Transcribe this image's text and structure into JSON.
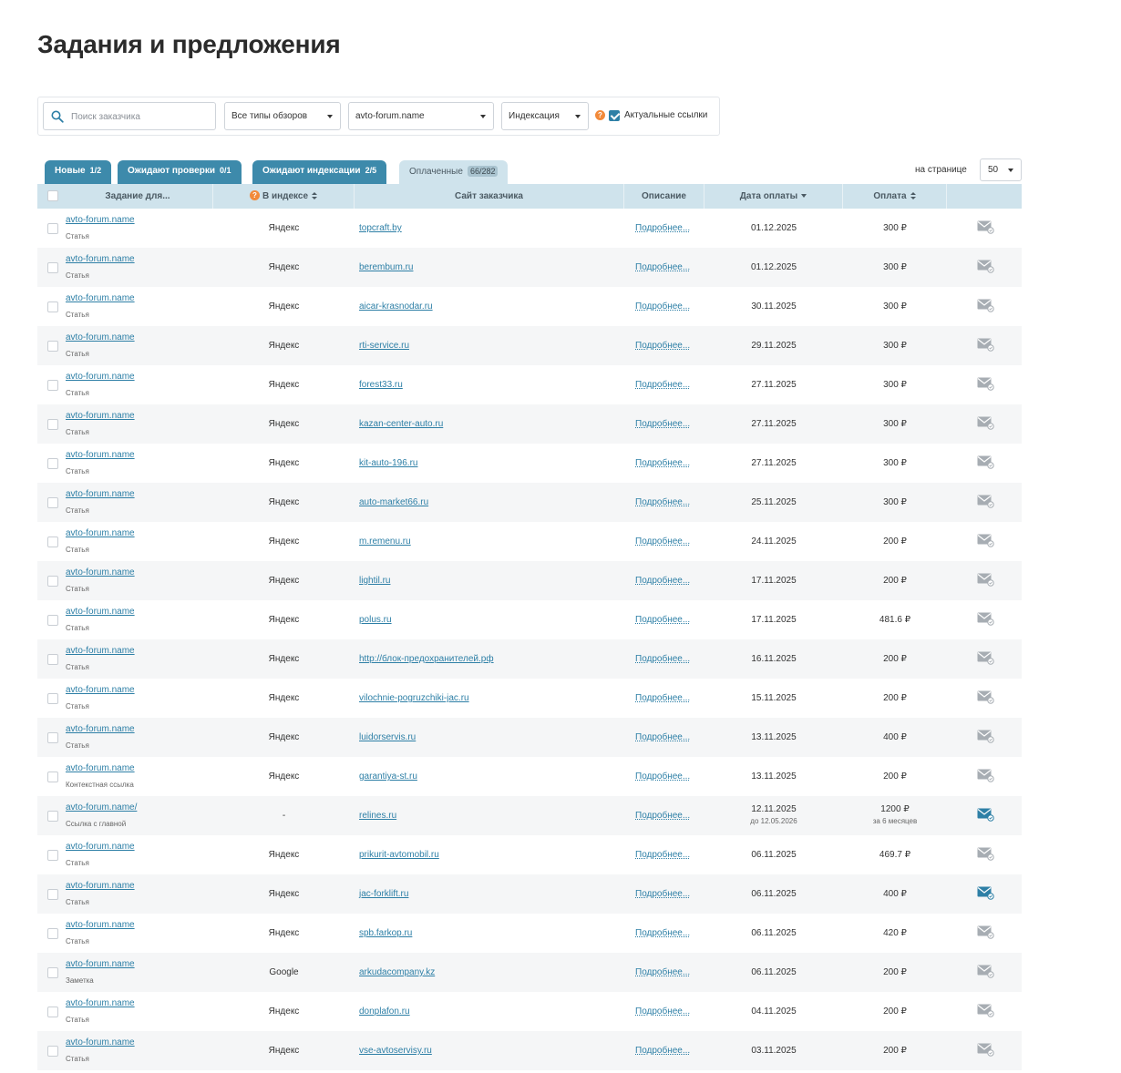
{
  "page": {
    "title": "Задания и предложения"
  },
  "filters": {
    "search_placeholder": "Поиск заказчика",
    "review_type": "Все типы обзоров",
    "site": "avto-forum.name",
    "indexing": "Индексация",
    "actual_links_label": "Актуальные ссылки",
    "actual_links_checked": true
  },
  "tabs": [
    {
      "label": "Новые",
      "count": "1/2"
    },
    {
      "label": "Ожидают проверки",
      "count": "0/1"
    },
    {
      "label": "Ожидают индексации",
      "count": "2/5"
    },
    {
      "label": "Оплаченные",
      "count": "66/282"
    }
  ],
  "per_page": {
    "label": "на странице",
    "value": "50"
  },
  "columns": {
    "task": "Задание для...",
    "index": "В индексе",
    "site": "Сайт заказчика",
    "desc": "Описание",
    "date": "Дата оплаты",
    "pay": "Оплата"
  },
  "colors": {
    "accent": "#3d8aab",
    "header_bg": "#cfe3ec",
    "link": "#2d7fa6",
    "info": "#f28a3a"
  },
  "rows": [
    {
      "task": "avto-forum.name",
      "type": "Статья",
      "index": "Яндекс",
      "site": "topcraft.by",
      "desc": "Подробнее...",
      "date": "01.12.2025",
      "pay": "300 ₽",
      "mail": "mail-icon"
    },
    {
      "task": "avto-forum.name",
      "type": "Статья",
      "index": "Яндекс",
      "site": "berembum.ru",
      "desc": "Подробнее...",
      "date": "01.12.2025",
      "pay": "300 ₽",
      "mail": "mail-icon"
    },
    {
      "task": "avto-forum.name",
      "type": "Статья",
      "index": "Яндекс",
      "site": "aicar-krasnodar.ru",
      "desc": "Подробнее...",
      "date": "30.11.2025",
      "pay": "300 ₽",
      "mail": "mail-icon"
    },
    {
      "task": "avto-forum.name",
      "type": "Статья",
      "index": "Яндекс",
      "site": "rti-service.ru",
      "desc": "Подробнее...",
      "date": "29.11.2025",
      "pay": "300 ₽",
      "mail": "mail-icon"
    },
    {
      "task": "avto-forum.name",
      "type": "Статья",
      "index": "Яндекс",
      "site": "forest33.ru",
      "desc": "Подробнее...",
      "date": "27.11.2025",
      "pay": "300 ₽",
      "mail": "mail-icon"
    },
    {
      "task": "avto-forum.name",
      "type": "Статья",
      "index": "Яндекс",
      "site": "kazan-center-auto.ru",
      "desc": "Подробнее...",
      "date": "27.11.2025",
      "pay": "300 ₽",
      "mail": "mail-icon"
    },
    {
      "task": "avto-forum.name",
      "type": "Статья",
      "index": "Яндекс",
      "site": "kit-auto-196.ru",
      "desc": "Подробнее...",
      "date": "27.11.2025",
      "pay": "300 ₽",
      "mail": "mail-icon"
    },
    {
      "task": "avto-forum.name",
      "type": "Статья",
      "index": "Яндекс",
      "site": "auto-market66.ru",
      "desc": "Подробнее...",
      "date": "25.11.2025",
      "pay": "300 ₽",
      "mail": "mail-icon"
    },
    {
      "task": "avto-forum.name",
      "type": "Статья",
      "index": "Яндекс",
      "site": "m.remenu.ru",
      "desc": "Подробнее...",
      "date": "24.11.2025",
      "pay": "200 ₽",
      "mail": "mail-icon"
    },
    {
      "task": "avto-forum.name",
      "type": "Статья",
      "index": "Яндекс",
      "site": "lightil.ru",
      "desc": "Подробнее...",
      "date": "17.11.2025",
      "pay": "200 ₽",
      "mail": "mail-icon"
    },
    {
      "task": "avto-forum.name",
      "type": "Статья",
      "index": "Яндекс",
      "site": "polus.ru",
      "desc": "Подробнее...",
      "date": "17.11.2025",
      "pay": "481.6 ₽",
      "mail": "mail-icon"
    },
    {
      "task": "avto-forum.name",
      "type": "Статья",
      "index": "Яндекс",
      "site": "http://блок-предохранителей.рф",
      "desc": "Подробнее...",
      "date": "16.11.2025",
      "pay": "200 ₽",
      "mail": "mail-icon"
    },
    {
      "task": "avto-forum.name",
      "type": "Статья",
      "index": "Яндекс",
      "site": "vilochnie-pogruzchiki-jac.ru",
      "desc": "Подробнее...",
      "date": "15.11.2025",
      "pay": "200 ₽",
      "mail": "mail-icon"
    },
    {
      "task": "avto-forum.name",
      "type": "Статья",
      "index": "Яндекс",
      "site": "luidorservis.ru",
      "desc": "Подробнее...",
      "date": "13.11.2025",
      "pay": "400 ₽",
      "mail": "mail-icon"
    },
    {
      "task": "avto-forum.name",
      "type": "Контекстная ссылка",
      "index": "Яндекс",
      "site": "garantiya-st.ru",
      "desc": "Подробнее...",
      "date": "13.11.2025",
      "pay": "200 ₽",
      "mail": "mail-icon"
    },
    {
      "task": "avto-forum.name/",
      "type": "Ссылка с главной",
      "index": "-",
      "site": "relines.ru",
      "desc": "Подробнее...",
      "date": "12.11.2025",
      "date_sub": "до 12.05.2026",
      "pay": "1200 ₽",
      "pay_sub": "за 6 месяцев",
      "mail": "mail-unread-icon"
    },
    {
      "task": "avto-forum.name",
      "type": "Статья",
      "index": "Яндекс",
      "site": "prikurit-avtomobil.ru",
      "desc": "Подробнее...",
      "date": "06.11.2025",
      "pay": "469.7 ₽",
      "mail": "mail-icon"
    },
    {
      "task": "avto-forum.name",
      "type": "Статья",
      "index": "Яндекс",
      "site": "jac-forklift.ru",
      "desc": "Подробнее...",
      "date": "06.11.2025",
      "pay": "400 ₽",
      "mail": "mail-unread-icon"
    },
    {
      "task": "avto-forum.name",
      "type": "Статья",
      "index": "Яндекс",
      "site": "spb.farkop.ru",
      "desc": "Подробнее...",
      "date": "06.11.2025",
      "pay": "420 ₽",
      "mail": "mail-icon"
    },
    {
      "task": "avto-forum.name",
      "type": "Заметка",
      "index": "Google",
      "site": "arkudacompany.kz",
      "desc": "Подробнее...",
      "date": "06.11.2025",
      "pay": "200 ₽",
      "mail": "mail-icon"
    },
    {
      "task": "avto-forum.name",
      "type": "Статья",
      "index": "Яндекс",
      "site": "donplafon.ru",
      "desc": "Подробнее...",
      "date": "04.11.2025",
      "pay": "200 ₽",
      "mail": "mail-icon"
    },
    {
      "task": "avto-forum.name",
      "type": "Статья",
      "index": "Яндекс",
      "site": "vse-avtoservisy.ru",
      "desc": "Подробнее...",
      "date": "03.11.2025",
      "pay": "200 ₽",
      "mail": "mail-icon"
    }
  ]
}
